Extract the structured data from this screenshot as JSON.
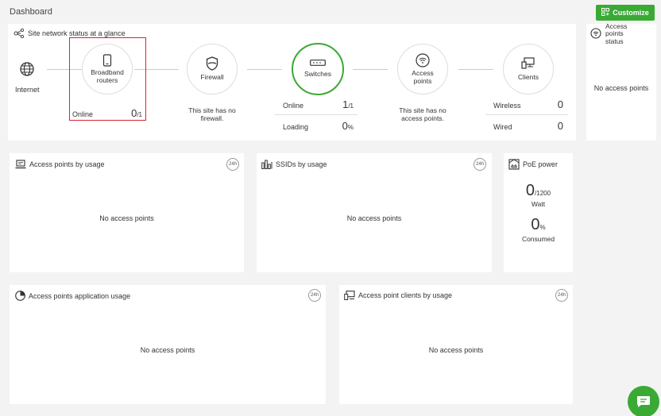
{
  "header": {
    "title": "Dashboard",
    "customize_label": "Customize"
  },
  "status": {
    "title": "Site network status at a glance",
    "internet_label": "Internet",
    "broadband": {
      "label_line1": "Broadband",
      "label_line2": "routers",
      "online_label": "Online",
      "online_value": "0",
      "online_total": "/1"
    },
    "firewall": {
      "label": "Firewall",
      "message_line1": "This site has no",
      "message_line2": "firewall."
    },
    "switches": {
      "label": "Switches",
      "online_label": "Online",
      "online_value": "1",
      "online_total": "/1",
      "loading_label": "Loading",
      "loading_value": "0",
      "loading_unit": "%"
    },
    "access_points": {
      "label_line1": "Access",
      "label_line2": "points",
      "message_line1": "This site has no",
      "message_line2": "access points."
    },
    "clients": {
      "label": "Clients",
      "wireless_label": "Wireless",
      "wireless_value": "0",
      "wired_label": "Wired",
      "wired_value": "0"
    }
  },
  "ap_status": {
    "title_line1": "Access",
    "title_line2": "points",
    "title_line3": "status",
    "message": "No access points"
  },
  "ap_usage": {
    "title": "Access points by usage",
    "badge": "24h",
    "message": "No access points"
  },
  "ssid_usage": {
    "title": "SSIDs by usage",
    "badge": "24h",
    "message": "No access points"
  },
  "poe": {
    "title": "PoE power",
    "watt_value": "0",
    "watt_total": "/1200",
    "watt_label": "Watt",
    "consumed_value": "0",
    "consumed_unit": "%",
    "consumed_label": "Consumed"
  },
  "app_usage": {
    "title": "Access points application usage",
    "badge": "24h",
    "message": "No access points"
  },
  "client_usage": {
    "title": "Access point clients by usage",
    "badge": "24h",
    "message": "No access points"
  },
  "colors": {
    "accent": "#3aaa35",
    "highlight": "#d9232e"
  }
}
